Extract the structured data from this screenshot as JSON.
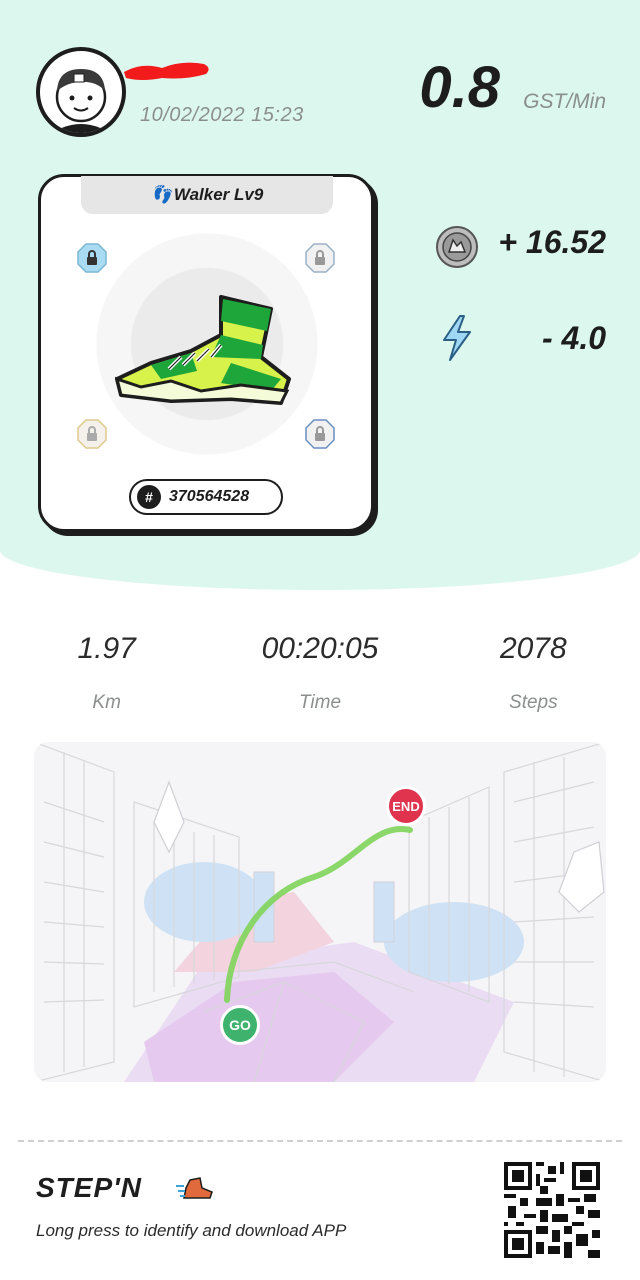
{
  "header": {
    "datetime": "10/02/2022 15:23",
    "gst_rate_value": "0.8",
    "gst_rate_unit": "GST/Min"
  },
  "sneaker": {
    "type_label": "Walker Lv9",
    "id_number": "370564528",
    "colors": {
      "primary": "#1ea63a",
      "secondary": "#d7f24a",
      "outline": "#1d1d1d"
    }
  },
  "earnings": {
    "gst_earned": "+ 16.52",
    "energy_used": "- 4.0"
  },
  "stats": [
    {
      "value": "1.97",
      "label": "Km"
    },
    {
      "value": "00:20:05",
      "label": "Time"
    },
    {
      "value": "2078",
      "label": "Steps"
    }
  ],
  "map": {
    "start_label": "GO",
    "end_label": "END",
    "route_color": "#7fd45a"
  },
  "footer": {
    "brand": "STEP'N",
    "instruction": "Long press to identify and download APP"
  },
  "theme": {
    "accent_bg": "#dcf7ee",
    "go_color": "#3fb36d",
    "end_color": "#e0334d"
  }
}
